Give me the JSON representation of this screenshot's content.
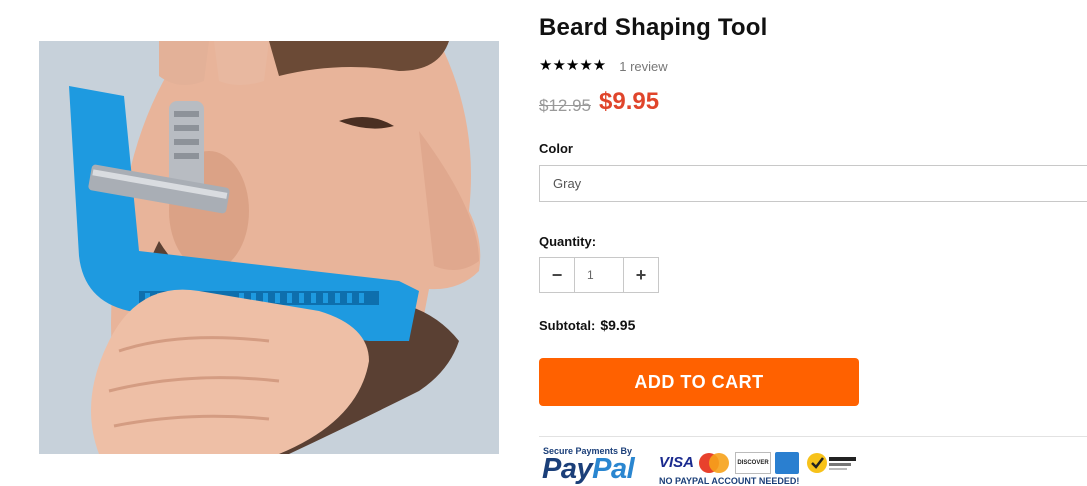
{
  "product": {
    "title": "Beard Shaping Tool",
    "rating_stars": "★★★★★",
    "rating_value": 5,
    "review_count": "1 review",
    "old_price": "$12.95",
    "sale_price": "$9.95"
  },
  "options": {
    "color_label": "Color",
    "color_value": "Gray"
  },
  "quantity": {
    "label": "Quantity:",
    "value": "1",
    "minus_symbol": "−",
    "plus_symbol": "+"
  },
  "subtotal": {
    "label": "Subtotal:",
    "value": "$9.95"
  },
  "cart": {
    "button_label": "ADD TO CART"
  },
  "trust_badges": {
    "paypal_heading": "Secure Payments By",
    "paypal_pay": "Pay",
    "paypal_pal": "Pal",
    "paypal_note": "NO PAYPAL ACCOUNT NEEDED!",
    "visa": "VISA",
    "discover": "DISCOVER"
  },
  "colors": {
    "sale_price": "#e0452b",
    "button": "#ff6100",
    "paypal_dark": "#1b3f79",
    "paypal_light": "#2a86d0",
    "tool_blue": "#1e9ae0"
  },
  "icons": [
    "star-icon",
    "minus-icon",
    "plus-icon",
    "mastercard-icon",
    "amex-icon",
    "norton-icon"
  ]
}
